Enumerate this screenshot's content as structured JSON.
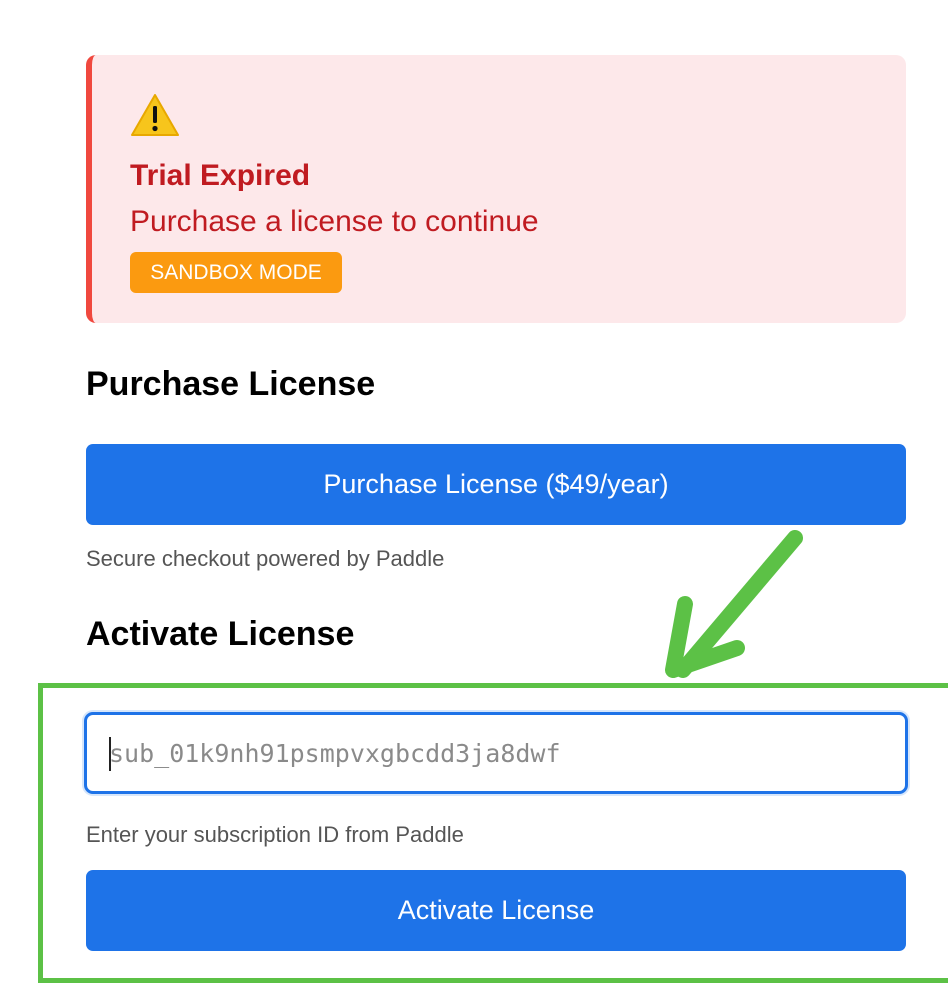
{
  "alert": {
    "icon": "warning-icon",
    "title": "Trial Expired",
    "message": "Purchase a license to continue",
    "badge": "SANDBOX MODE",
    "colors": {
      "background": "#fde8ea",
      "border": "#f0483e",
      "text": "#c01b21",
      "badge": "#fb9a10"
    }
  },
  "purchase": {
    "heading": "Purchase License",
    "button_label": "Purchase License ($49/year)",
    "help": "Secure checkout powered by Paddle"
  },
  "activate": {
    "heading": "Activate License",
    "input_placeholder": "sub_01k9nh91psmpvxgbcdd3ja8dwf",
    "help": "Enter your subscription ID from Paddle",
    "button_label": "Activate License"
  },
  "annotation": {
    "icon": "arrow-icon",
    "color": "#5cc146"
  },
  "colors": {
    "primary": "#1e73e8"
  }
}
